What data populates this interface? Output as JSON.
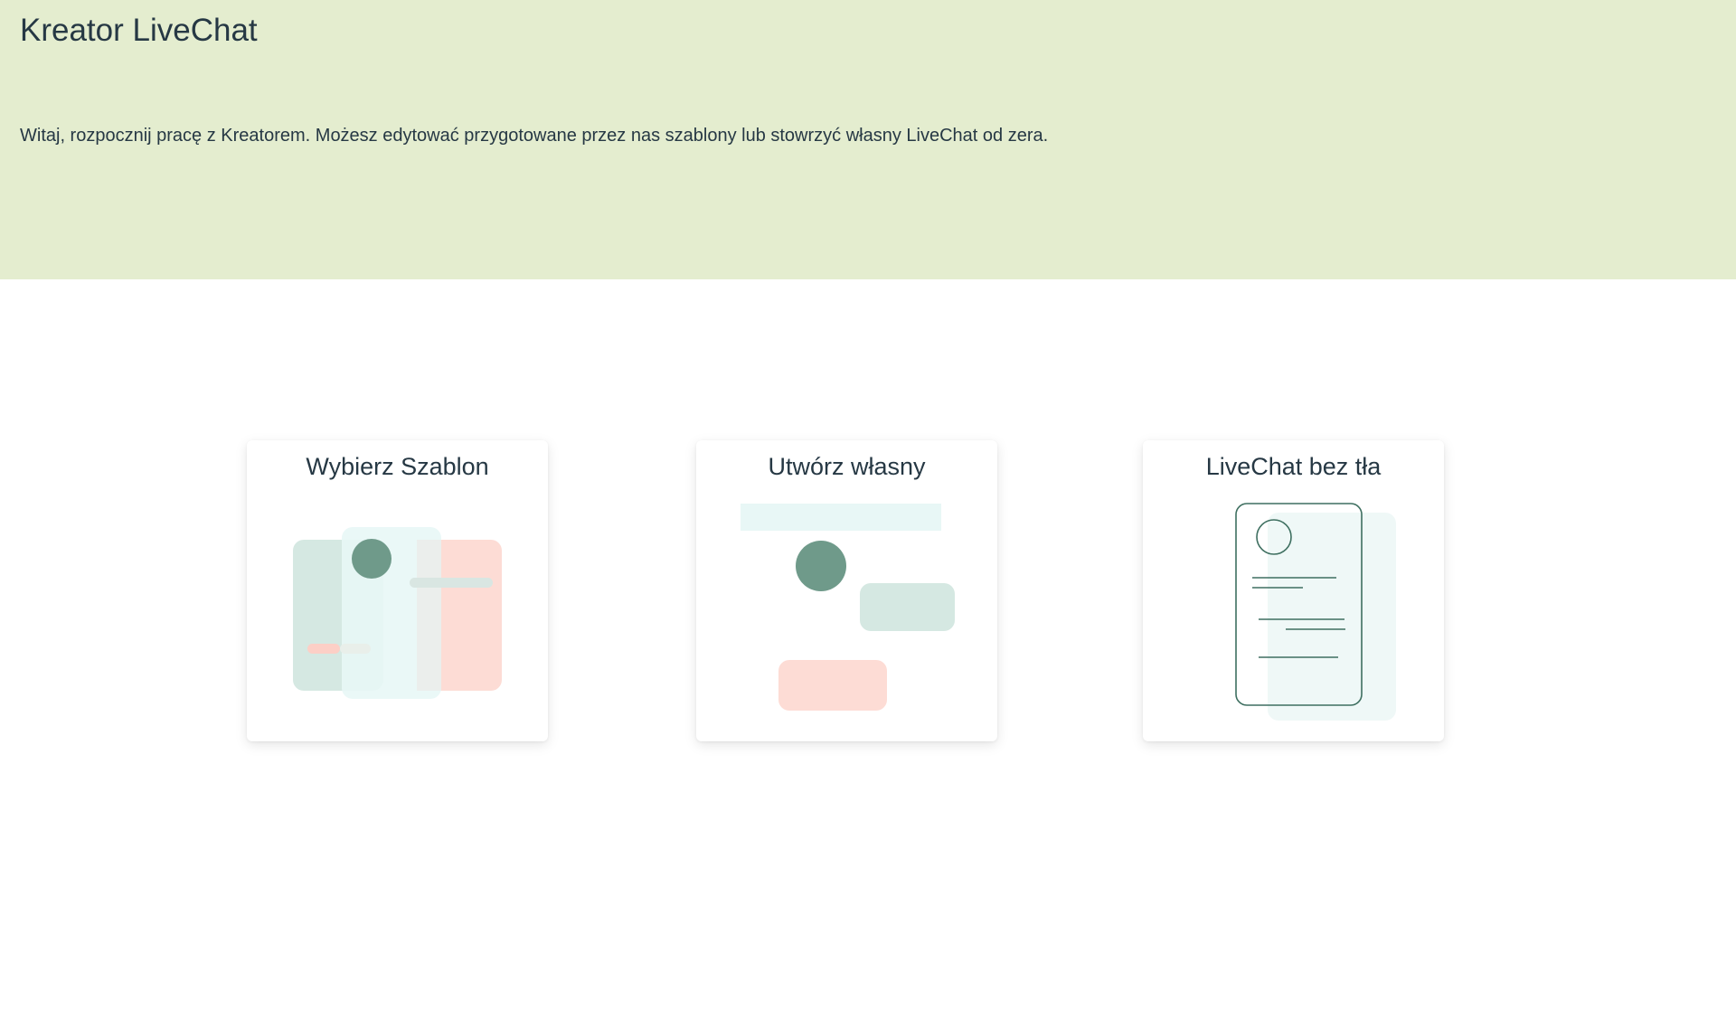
{
  "header": {
    "title": "Kreator LiveChat",
    "intro": "Witaj, rozpocznij pracę z Kreatorem. Możesz edytować przygotowane przez nas szablony lub stowrzyć własny LiveChat od zera."
  },
  "cards": [
    {
      "label": "Wybierz Szablon",
      "icon": "templates-illustration-icon"
    },
    {
      "label": "Utwórz własny",
      "icon": "custom-chat-illustration-icon"
    },
    {
      "label": "LiveChat bez tła",
      "icon": "transparent-phone-illustration-icon"
    }
  ],
  "colors": {
    "header_bg": "#e4edcf",
    "text": "#263844",
    "accent_green": "#6f9a8a",
    "light_green": "#d5e8e2",
    "light_cyan": "#e8f7f6",
    "pink": "#fddcd5"
  }
}
